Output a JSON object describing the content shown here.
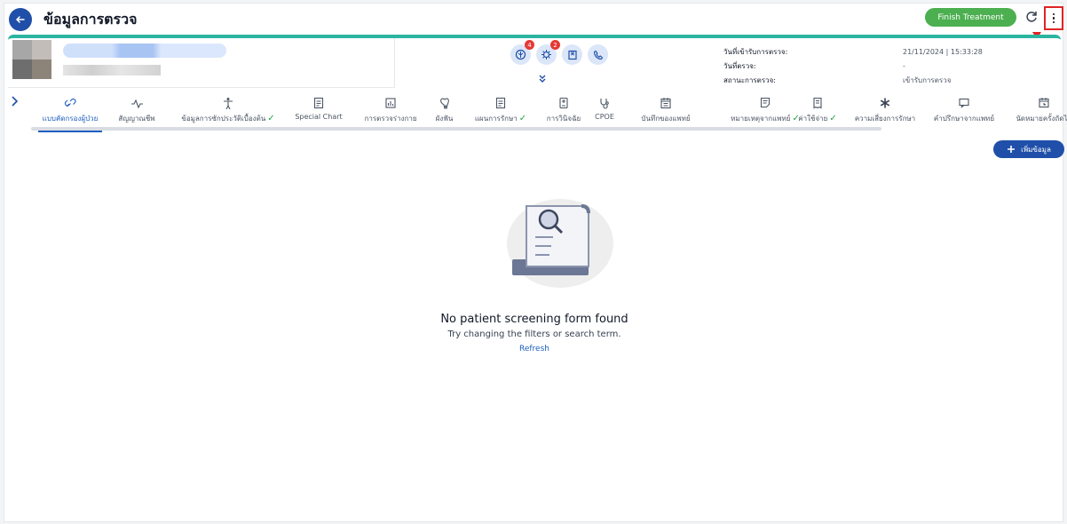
{
  "header": {
    "title": "ข้อมูลการตรวจ",
    "finish_label": "Finish Treatment"
  },
  "patient": {
    "badges": [
      "4",
      "2"
    ],
    "info_labels": [
      "วันที่เข้ารับการตรวจ:",
      "วันที่ตรวจ:",
      "สถานะการตรวจ:"
    ],
    "info_values": [
      "21/11/2024 | 15:33:28",
      "-",
      "เข้ารับการตรวจ"
    ]
  },
  "tabs": [
    {
      "label": "แบบคัดกรองผู้ป่วย",
      "icon": "link-icon",
      "check": false
    },
    {
      "label": "สัญญาณชีพ",
      "icon": "pulse-icon",
      "check": false
    },
    {
      "label": "ข้อมูลการซักประวัติเบื้องต้น",
      "icon": "person-icon",
      "check": true
    },
    {
      "label": "Special Chart",
      "icon": "chart-doc-icon",
      "check": false
    },
    {
      "label": "การตรวจร่างกาย",
      "icon": "exam-icon",
      "check": false
    },
    {
      "label": "ผังฟัน",
      "icon": "tooth-icon",
      "check": false
    },
    {
      "label": "แผนการรักษา",
      "icon": "plan-icon",
      "check": true
    },
    {
      "label": "การวินิจฉัย",
      "icon": "diagnosis-icon",
      "check": false
    },
    {
      "label": "CPOE",
      "icon": "stethoscope-icon",
      "check": false
    },
    {
      "label": "บันทึกของแพทย์",
      "icon": "calendar-note-icon",
      "check": false
    },
    {
      "label": "หมายเหตุจากแพทย์",
      "icon": "note-icon",
      "check": true
    },
    {
      "label": "ค่าใช้จ่าย",
      "icon": "receipt-icon",
      "check": true
    },
    {
      "label": "ความเสี่ยงการรักษา",
      "icon": "asterisk-icon",
      "check": false
    },
    {
      "label": "คำปรึกษาจากแพทย์",
      "icon": "chat-icon",
      "check": false
    },
    {
      "label": "นัดหมายครั้งถัดไป",
      "icon": "appointment-icon",
      "check": false
    }
  ],
  "add_button": "เพิ่มข้อมูล",
  "empty": {
    "title": "No patient screening form found",
    "subtitle": "Try changing the filters or search term.",
    "refresh": "Refresh"
  },
  "colors": {
    "primary": "#1f4fa8",
    "accent_teal": "#2bb5a0",
    "finish_green": "#4caf50",
    "check_green": "#22a344",
    "annotation_red": "#e02424"
  }
}
